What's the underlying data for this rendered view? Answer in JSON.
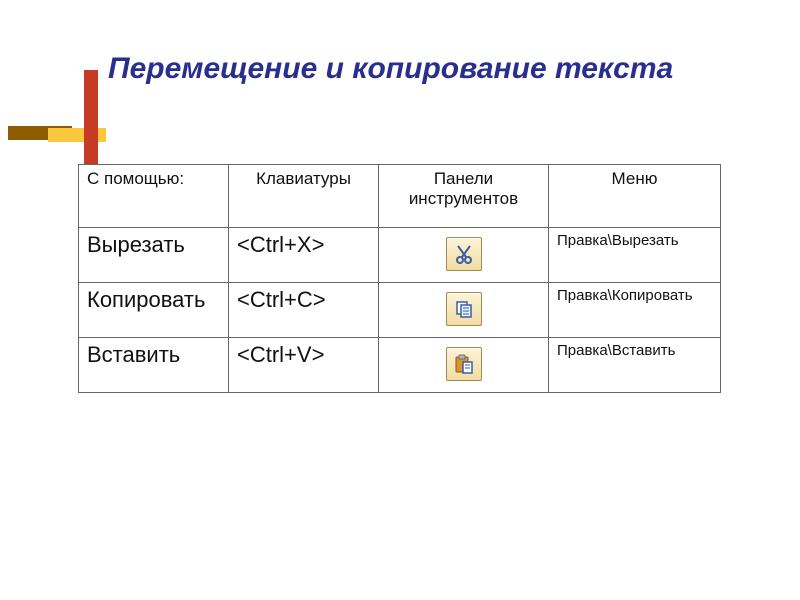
{
  "title": "Перемещение и копирование текста",
  "headers": {
    "c1": "С помощью:",
    "c2": "Клавиатуры",
    "c3": "Панели инструментов",
    "c4": "Меню"
  },
  "rows": [
    {
      "action": "Вырезать",
      "keys": "<Ctrl+X>",
      "icon": "cut-icon",
      "menu": "Правка\\Вырезать"
    },
    {
      "action": "Копировать",
      "keys": "<Ctrl+C>",
      "icon": "copy-icon",
      "menu": "Правка\\Копировать"
    },
    {
      "action": "Вставить",
      "keys": "<Ctrl+V>",
      "icon": "paste-icon",
      "menu": "Правка\\Вставить"
    }
  ]
}
